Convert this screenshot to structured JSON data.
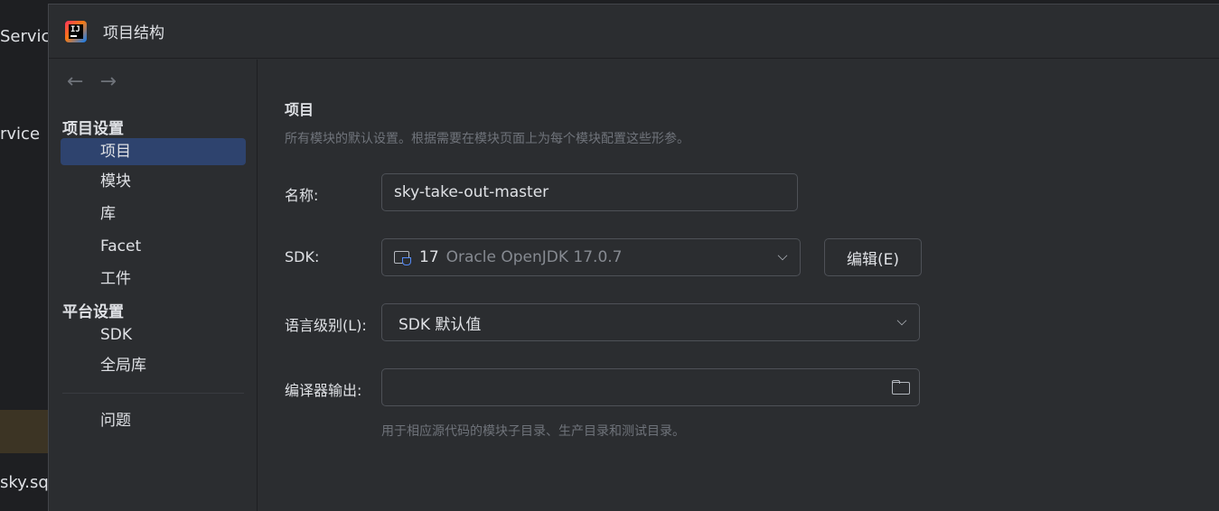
{
  "background": {
    "snippets": [
      "Servic",
      "rvice",
      "sky.sq"
    ]
  },
  "dialog": {
    "title": "项目结构",
    "app_icon_text": "IJ"
  },
  "sidebar": {
    "back_icon": "←",
    "forward_icon": "→",
    "section_project": "项目设置",
    "items_project": [
      "项目",
      "模块",
      "库",
      "Facet",
      "工件"
    ],
    "section_platform": "平台设置",
    "items_platform": [
      "SDK",
      "全局库"
    ],
    "problems": "问题"
  },
  "main": {
    "heading": "项目",
    "description": "所有模块的默认设置。根据需要在模块页面上为每个模块配置这些形参。",
    "name_label": "名称:",
    "name_value": "sky-take-out-master",
    "sdk_label": "SDK:",
    "sdk_version": "17",
    "sdk_name": "Oracle OpenJDK 17.0.7",
    "edit_button": "编辑(E)",
    "language_label": "语言级别(L):",
    "language_value": "SDK 默认值",
    "compiler_label": "编译器输出:",
    "compiler_value": "",
    "compiler_hint": "用于相应源代码的模块子目录、生产目录和测试目录。"
  }
}
